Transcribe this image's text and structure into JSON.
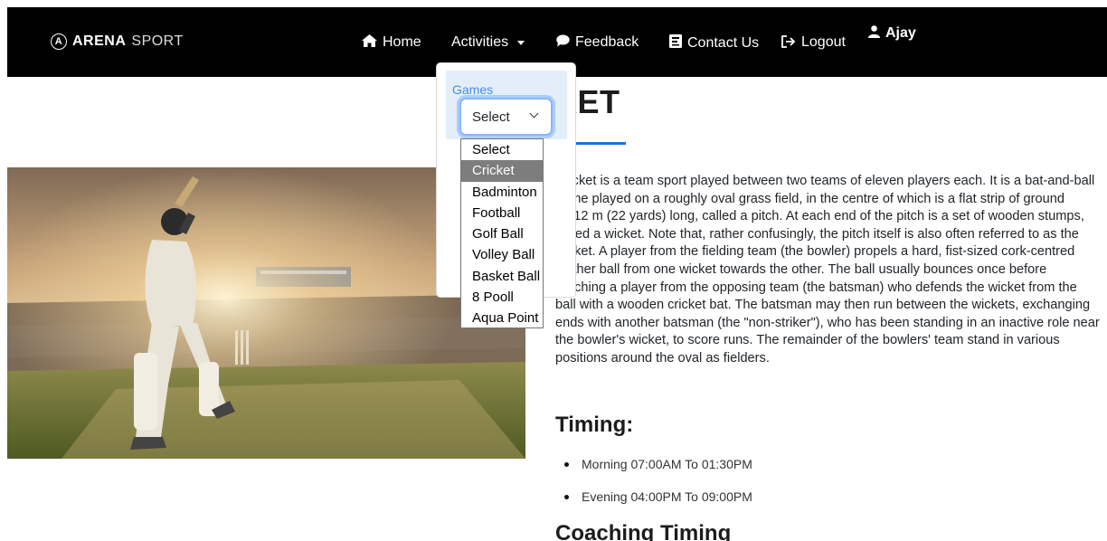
{
  "brand": {
    "mark": "A",
    "name_bold": "ARENA",
    "name_light": "SPORT"
  },
  "nav": {
    "home": "Home",
    "activities": "Activities",
    "feedback": "Feedback",
    "contact": "Contact Us",
    "logout": "Logout",
    "user": "Ajay"
  },
  "dropdown": {
    "label": "Games",
    "selected_value": "Select",
    "options": [
      "Select",
      "Cricket",
      "Badminton",
      "Football",
      "Golf Ball",
      "Volley Ball",
      "Basket Ball",
      "8 Pooll",
      "Aqua Point"
    ],
    "highlighted_option": "Cricket"
  },
  "content": {
    "title": "CRICKET",
    "title_visible": "KET",
    "description": "Cricket is a team sport played between two teams of eleven players each. It is a bat-and-ball game played on a roughly oval grass field, in the centre of which is a flat strip of ground 20.12 m (22 yards) long, called a pitch. At each end of the pitch is a set of wooden stumps, called a wicket. Note that, rather confusingly, the pitch itself is also often referred to as the wicket. A player from the fielding team (the bowler) propels a hard, fist-sized cork-centred leather ball from one wicket towards the other. The ball usually bounces once before reaching a player from the opposing team (the batsman) who defends the wicket from the ball with a wooden cricket bat. The batsman may then run between the wickets, exchanging ends with another batsman (the \"non-striker\"), who has been standing in an inactive role near the bowler's wicket, to score runs. The remainder of the bowlers' team stand in various positions around the oval as fielders.",
    "timing_heading": "Timing:",
    "timings": [
      "Morning 07:00AM To 01:30PM",
      "Evening 04:00PM To 09:00PM"
    ],
    "coaching_heading": "Coaching Timing"
  },
  "colors": {
    "navbar": "#000000",
    "accent": "#1a73d9",
    "dropdown_label": "#4a8de0",
    "option_highlight": "#7d7d7d"
  },
  "icons": [
    "home-icon",
    "comment-icon",
    "address-card-icon",
    "sign-out-icon",
    "user-icon"
  ]
}
